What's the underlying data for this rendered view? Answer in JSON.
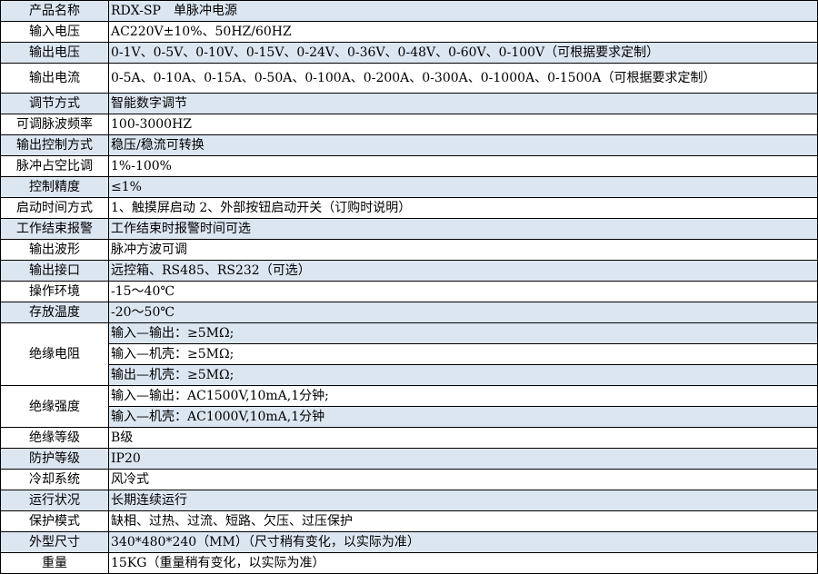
{
  "rows": [
    {
      "label": "产品名称",
      "value": "RDX-SP　单脉冲电源"
    },
    {
      "label": "输入电压",
      "value": "AC220V±10%、50HZ/60HZ"
    },
    {
      "label": "输出电压",
      "value": "0-1V、0-5V、0-10V、0-15V、0-24V、0-36V、0-48V、0-60V、0-100V（可根据要求定制）"
    },
    {
      "label": "输出电流",
      "value": "0-5A、0-10A、0-15A、0-50A、0-100A、0-200A、0-300A、0-1000A、0-1500A（可根据要求定制）"
    },
    {
      "label": "调节方式",
      "value": "智能数字调节"
    },
    {
      "label": "可调脉波频率",
      "value": "100-3000HZ"
    },
    {
      "label": "输出控制方式",
      "value": "稳压/稳流可转换"
    },
    {
      "label": "脉冲占空比调",
      "value": "1%-100%"
    },
    {
      "label": "控制精度",
      "value": "≤1%"
    },
    {
      "label": "启动时间方式",
      "value": "1、触摸屏启动 2、外部按钮启动开关（订购时说明）"
    },
    {
      "label": "工作结束报警",
      "value": "工作结束时报警时间可选"
    },
    {
      "label": "输出波形",
      "value": "脉冲方波可调"
    },
    {
      "label": "输出接口",
      "value": "远控箱、RS485、RS232（可选）"
    },
    {
      "label": "操作环境",
      "value": "-15～40℃"
    },
    {
      "label": "存放温度",
      "value": "-20～50℃"
    }
  ],
  "insulation_resistance": {
    "label": "绝缘电阻",
    "values": [
      "输入—输出：≥5MΩ;",
      "输入—机壳：≥5MΩ;",
      "输出—机壳：≥5MΩ;"
    ]
  },
  "insulation_strength": {
    "label": "绝缘强度",
    "values": [
      "输入—输出：AC1500V,10mA,1分钟;",
      "输入—机壳：AC1000V,10mA,1分钟"
    ]
  },
  "rows2": [
    {
      "label": "绝缘等级",
      "value": "B级"
    },
    {
      "label": "防护等级",
      "value": "IP20"
    },
    {
      "label": "冷却系统",
      "value": "风冷式"
    },
    {
      "label": "运行状况",
      "value": "长期连续运行"
    },
    {
      "label": "保护模式",
      "value": "缺相、过热、过流、短路、欠压、过压保护"
    },
    {
      "label": "外型尺寸",
      "value": "340*480*240（MM）（尺寸稍有变化，以实际为准）"
    },
    {
      "label": "重量",
      "value": "15KG（重量稍有变化，以实际为准）"
    }
  ],
  "colors": {
    "row_blue": "#dce6f1",
    "row_white": "#ffffff",
    "border": "#000000"
  }
}
